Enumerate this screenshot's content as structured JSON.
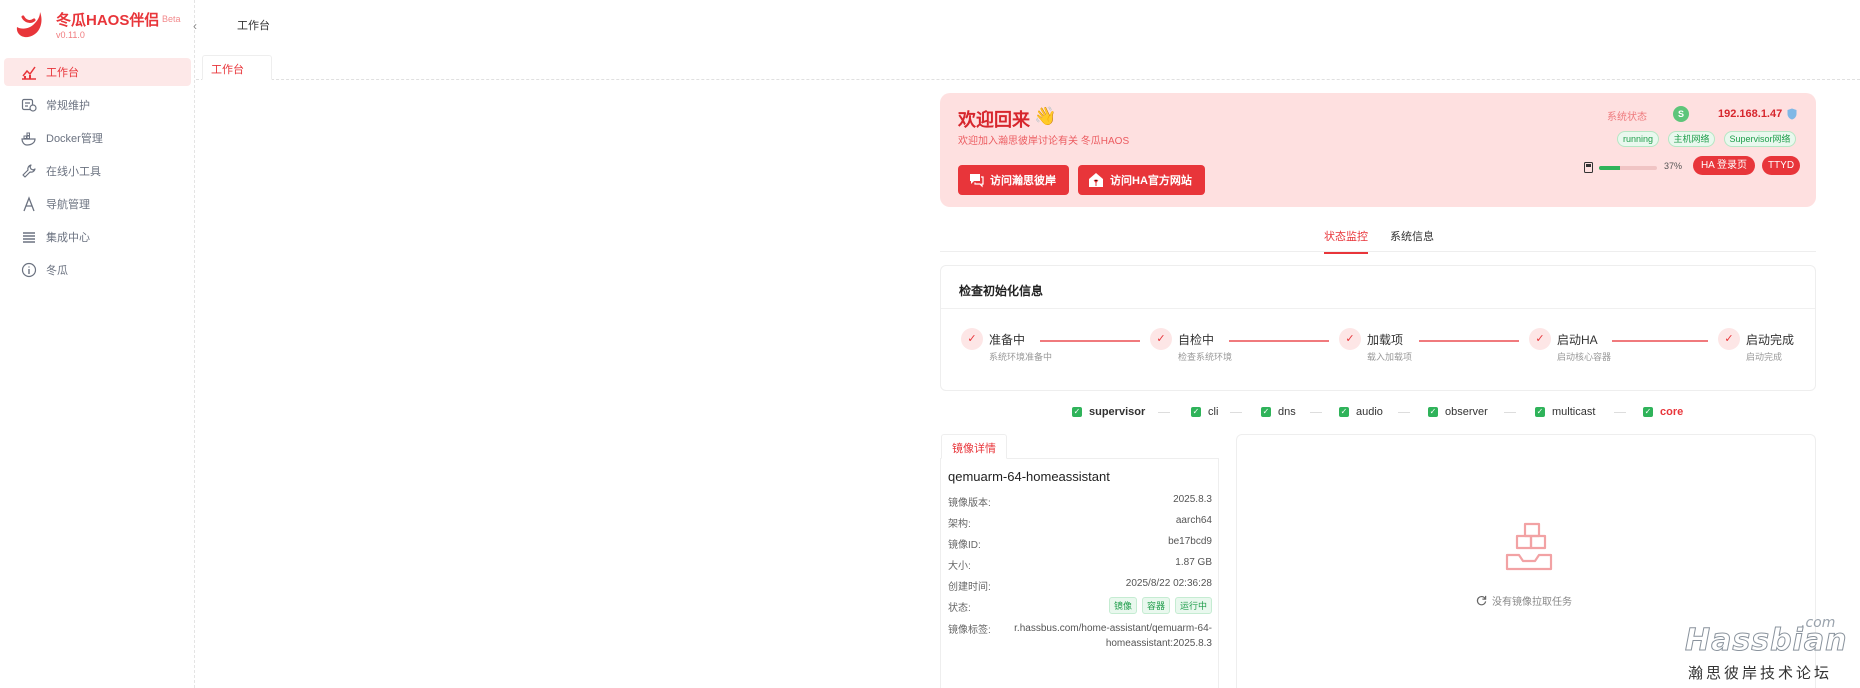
{
  "brand": {
    "name": "冬瓜HAOS伴侣",
    "beta": "Beta",
    "version": "v0.11.0",
    "color": "#e8353a"
  },
  "collapse_icon": "‹",
  "sidebar": {
    "items": [
      {
        "label": "工作台",
        "icon": "chart-line-icon",
        "active": true
      },
      {
        "label": "常规维护",
        "icon": "maintenance-icon",
        "active": false
      },
      {
        "label": "Docker管理",
        "icon": "docker-icon",
        "active": false
      },
      {
        "label": "在线小工具",
        "icon": "wrench-icon",
        "active": false
      },
      {
        "label": "导航管理",
        "icon": "navigation-icon",
        "active": false
      },
      {
        "label": "集成中心",
        "icon": "layers-icon",
        "active": false
      },
      {
        "label": "冬瓜",
        "icon": "info-icon",
        "active": false
      }
    ]
  },
  "header": {
    "title": "工作台"
  },
  "page_tab": {
    "label": "工作台"
  },
  "welcome": {
    "title": "欢迎回来",
    "wave": "👋",
    "subtitle": "欢迎加入瀚思彼岸讨论有关 冬瓜HAOS",
    "btn_forum": "访问瀚思彼岸",
    "btn_ha": "访问HA官方网站",
    "sys_status_label": "系统状态",
    "sys_status_badge": "S",
    "ip": "192.168.1.47",
    "pills": [
      "running",
      "主机网络",
      "Supervisor网络"
    ],
    "progress": {
      "value": 37,
      "label": "37%"
    },
    "ha_login": "HA 登录页",
    "ttyd": "TTYD",
    "bg_color": "#fee0e0"
  },
  "tabs": [
    {
      "label": "状态监控",
      "active": true
    },
    {
      "label": "系统信息",
      "active": false
    }
  ],
  "init": {
    "title": "检查初始化信息",
    "check_mark": "✓",
    "steps": [
      {
        "title": "准备中",
        "desc": "系统环境准备中"
      },
      {
        "title": "自检中",
        "desc": "检查系统环境"
      },
      {
        "title": "加载项",
        "desc": "载入加载项"
      },
      {
        "title": "启动HA",
        "desc": "启动核心容器"
      },
      {
        "title": "启动完成",
        "desc": "启动完成"
      }
    ]
  },
  "services": [
    {
      "name": "supervisor",
      "bold": true
    },
    {
      "name": "cli",
      "bold": false
    },
    {
      "name": "dns",
      "bold": false
    },
    {
      "name": "audio",
      "bold": false
    },
    {
      "name": "observer",
      "bold": false
    },
    {
      "name": "multicast",
      "bold": false
    },
    {
      "name": "core",
      "bold": true,
      "color": "#e8353a"
    }
  ],
  "detail": {
    "tab": "镜像详情",
    "name": "qemuarm-64-homeassistant",
    "rows": [
      {
        "label": "镜像版本:",
        "value": "2025.8.3"
      },
      {
        "label": "架构:",
        "value": "aarch64"
      },
      {
        "label": "镜像ID:",
        "value": "be17bcd9"
      },
      {
        "label": "大小:",
        "value": "1.87 GB"
      },
      {
        "label": "创建时间:",
        "value": "2025/8/22 02:36:28"
      }
    ],
    "status_label": "状态:",
    "status_tags": [
      "镜像",
      "容器",
      "运行中"
    ],
    "tag_label": "镜像标签:",
    "tag_value": "r.hassbus.com/home-assistant/qemuarm-64-homeassistant:2025.8.3"
  },
  "empty": {
    "text": "没有镜像拉取任务"
  },
  "watermark": {
    "name": "Hassbian",
    "com": ".com",
    "cn": "瀚思彼岸技术论坛"
  }
}
